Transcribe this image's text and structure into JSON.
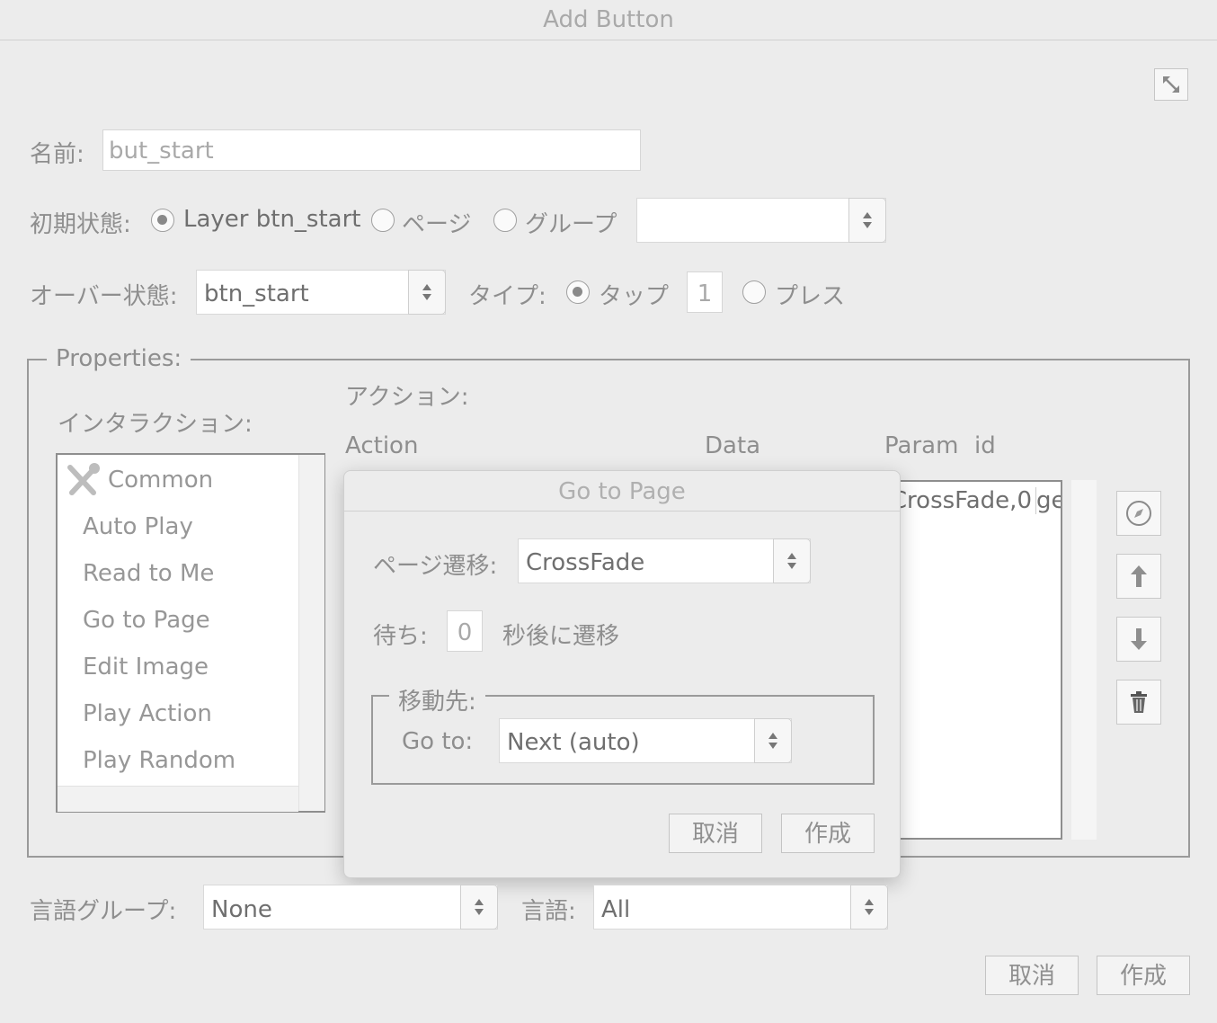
{
  "window": {
    "title": "Add Button"
  },
  "name": {
    "label": "名前:",
    "value": "but_start"
  },
  "initial_state": {
    "label": "初期状態:",
    "options": [
      {
        "label": "Layer btn_start",
        "selected": true
      },
      {
        "label": "ページ",
        "selected": false
      },
      {
        "label": "グループ",
        "selected": false
      }
    ],
    "select_value": ""
  },
  "over_state": {
    "label": "オーバー状態:",
    "value": "btn_start"
  },
  "type": {
    "label": "タイプ:",
    "tap_label": "タップ",
    "tap_selected": true,
    "tap_count": "1",
    "press_label": "プレス",
    "press_selected": false
  },
  "properties": {
    "legend": "Properties:",
    "interaction_label": "インタラクション:",
    "interaction_items": [
      {
        "label": "Common",
        "icon": "tools-icon"
      },
      {
        "label": "Auto Play"
      },
      {
        "label": "Read to Me"
      },
      {
        "label": "Go to Page"
      },
      {
        "label": "Edit Image"
      },
      {
        "label": "Play Action"
      },
      {
        "label": "Play Random"
      }
    ],
    "action_label": "アクション:",
    "columns": [
      "Action",
      "Data",
      "Param",
      "id"
    ],
    "row_partial": {
      "param": "CrossFade,0",
      "id": "ge"
    },
    "side_icons": [
      "compass-icon",
      "arrow-up-icon",
      "arrow-down-icon",
      "trash-icon"
    ]
  },
  "goto_dialog": {
    "title": "Go to Page",
    "transition_label": "ページ遷移:",
    "transition_value": "CrossFade",
    "wait_label": "待ち:",
    "wait_value": "0",
    "wait_suffix": "秒後に遷移",
    "dest_legend": "移動先:",
    "goto_label": "Go to:",
    "goto_value": "Next (auto)",
    "cancel": "取消",
    "create": "作成"
  },
  "language_group": {
    "label": "言語グループ:",
    "value": "None"
  },
  "language": {
    "label": "言語:",
    "value": "All"
  },
  "footer": {
    "cancel": "取消",
    "create": "作成"
  }
}
